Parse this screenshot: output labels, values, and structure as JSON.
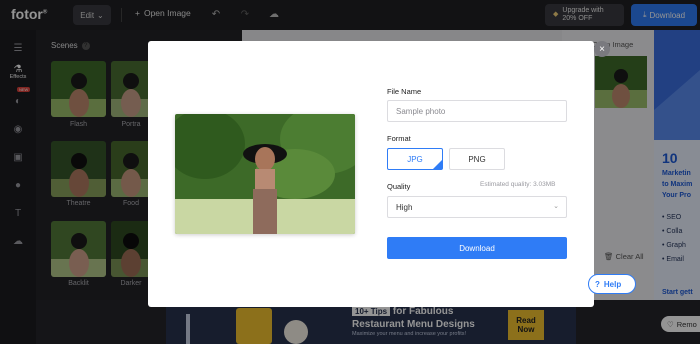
{
  "topbar": {
    "logo": "fotor",
    "edit_label": "Edit",
    "open_image_label": "Open Image",
    "upgrade_line1": "Upgrade with",
    "upgrade_line2": "20% OFF",
    "download_label": "Download",
    "icons": [
      "undo-icon",
      "redo-icon",
      "cloud-icon"
    ]
  },
  "sidebar": {
    "effects_label": "Effects",
    "new_badge": "NEW",
    "icons": [
      "adjust-icon",
      "effects-icon",
      "beauty-icon",
      "eye-icon",
      "frame-icon",
      "sticker-icon",
      "text-icon",
      "upload-icon"
    ]
  },
  "panel": {
    "title": "Scenes",
    "thumbs": [
      {
        "label": "Flash"
      },
      {
        "label": "Portra"
      },
      {
        "label": "Theatre"
      },
      {
        "label": "Food"
      },
      {
        "label": "Backlit"
      },
      {
        "label": "Darker"
      }
    ]
  },
  "right_panel": {
    "open_image_label": "Open Image",
    "clear_all_label": "Clear All"
  },
  "right_ad": {
    "big": "10",
    "line1": "Marketin",
    "line2": "to Maxim",
    "line3": "Your Pro",
    "items": [
      "SEO",
      "Colla",
      "Graph",
      "Email"
    ],
    "footer": "Start gett"
  },
  "bottom_ad": {
    "tip_box": "10+ Tips",
    "tip_rest": "for Fabulous",
    "line2": "Restaurant Menu Designs",
    "sub": "Maximize your menu and increase your profits!",
    "cta": "Read Now"
  },
  "remove_label": "Remo",
  "help_label": "Help",
  "modal": {
    "file_name_label": "File Name",
    "file_name_placeholder": "Sample photo",
    "format_label": "Format",
    "format_jpg": "JPG",
    "format_png": "PNG",
    "quality_label": "Quality",
    "quality_hint": "Estimated quality: 3.03MB",
    "quality_value": "High",
    "download_label": "Download",
    "close_label": "×"
  },
  "colors": {
    "accent": "#2f7cf6",
    "topbar": "#1f1f23"
  }
}
